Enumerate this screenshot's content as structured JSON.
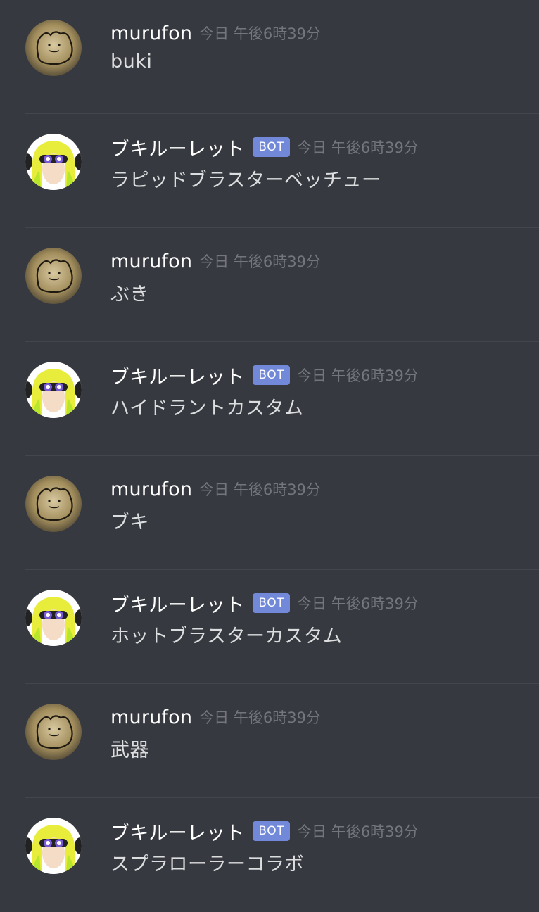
{
  "colors": {
    "background": "#36393f",
    "username": "#ffffff",
    "timestamp": "#72767d",
    "message_text": "#dcddde",
    "bot_badge": "#7289da",
    "divider": "#43464c"
  },
  "messages": [
    {
      "author": "murufon",
      "is_bot": false,
      "avatar": "ditto-avatar",
      "timestamp": "今日 午後6時39分",
      "text": "buki"
    },
    {
      "author": "ブキルーレット",
      "is_bot": true,
      "badge": "BOT",
      "avatar": "inkling-avatar",
      "timestamp": "今日 午後6時39分",
      "text": "ラピッドブラスターベッチュー"
    },
    {
      "author": "murufon",
      "is_bot": false,
      "avatar": "ditto-avatar",
      "timestamp": "今日 午後6時39分",
      "text": "ぶき"
    },
    {
      "author": "ブキルーレット",
      "is_bot": true,
      "badge": "BOT",
      "avatar": "inkling-avatar",
      "timestamp": "今日 午後6時39分",
      "text": "ハイドラントカスタム"
    },
    {
      "author": "murufon",
      "is_bot": false,
      "avatar": "ditto-avatar",
      "timestamp": "今日 午後6時39分",
      "text": "ブキ"
    },
    {
      "author": "ブキルーレット",
      "is_bot": true,
      "badge": "BOT",
      "avatar": "inkling-avatar",
      "timestamp": "今日 午後6時39分",
      "text": "ホットブラスターカスタム"
    },
    {
      "author": "murufon",
      "is_bot": false,
      "avatar": "ditto-avatar",
      "timestamp": "今日 午後6時39分",
      "text": "武器"
    },
    {
      "author": "ブキルーレット",
      "is_bot": true,
      "badge": "BOT",
      "avatar": "inkling-avatar",
      "timestamp": "今日 午後6時39分",
      "text": "スプラローラーコラボ"
    }
  ]
}
